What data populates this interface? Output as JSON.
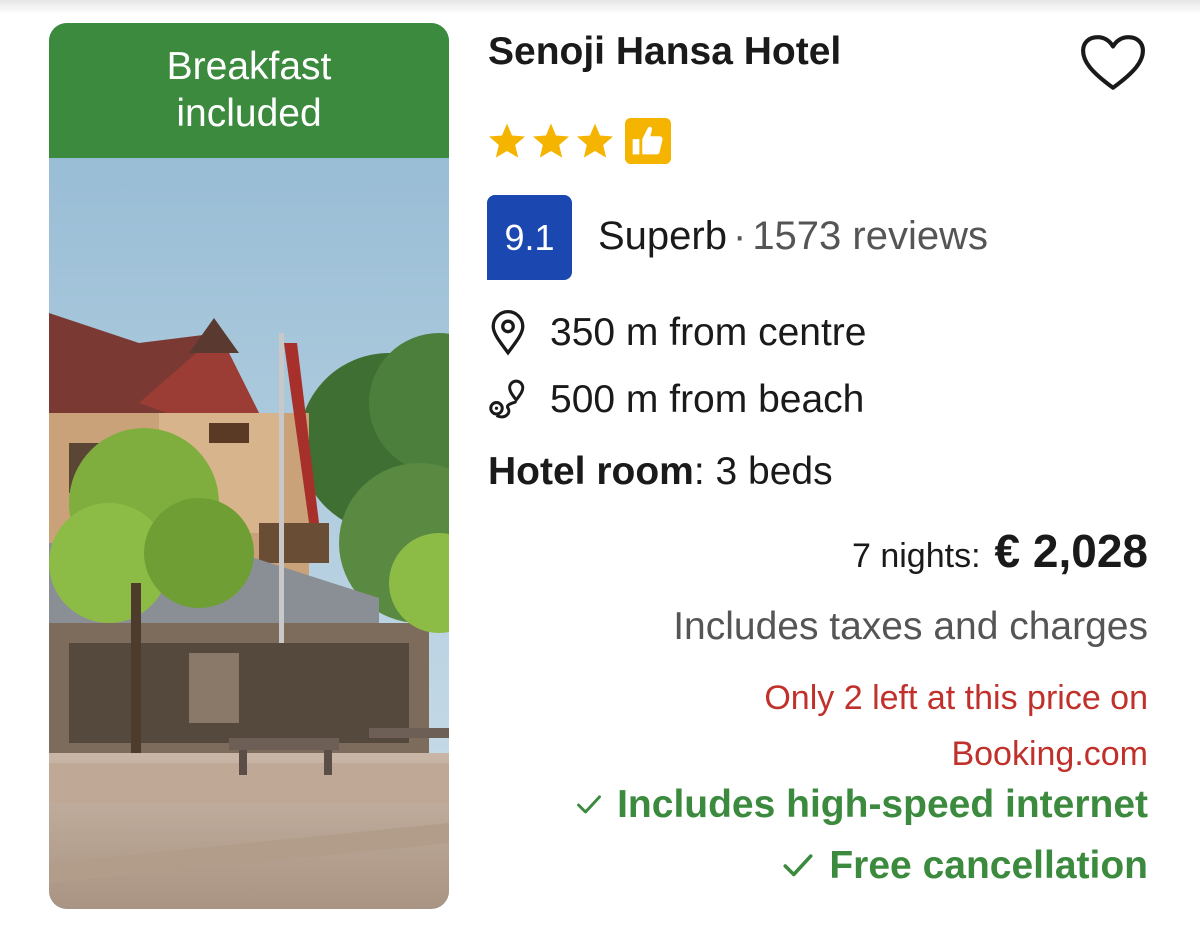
{
  "listing": {
    "badge": "Breakfast included",
    "title": "Senoji Hansa Hotel",
    "stars": 3,
    "rating": {
      "score": "9.1",
      "label": "Superb",
      "separator": "·",
      "reviews": "1573 reviews"
    },
    "distances": {
      "centre": "350 m from centre",
      "beach": "500 m from beach"
    },
    "room": {
      "label": "Hotel room",
      "separator": ":",
      "beds": "3 beds"
    },
    "price": {
      "nights": "7 nights:",
      "amount": "€ 2,028",
      "taxes": "Includes taxes and charges",
      "availability": "Only 2 left at this price on Booking.com"
    },
    "perks": [
      "Includes high-speed internet",
      "Free cancellation"
    ]
  },
  "colors": {
    "badge_green": "#3b8a3e",
    "score_blue": "#1a47b0",
    "star_yellow": "#f4b400",
    "urgency_red": "#c0312b"
  }
}
